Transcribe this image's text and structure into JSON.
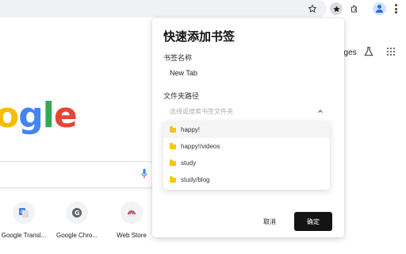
{
  "toolbar": {
    "icons": [
      "star-icon",
      "bookmark-star-icon",
      "extensions-puzzle-icon",
      "profile-avatar-icon",
      "more-menu-icon"
    ]
  },
  "ntp": {
    "link_fragment": "ages",
    "logo_fragment": [
      "o",
      "g",
      "l",
      "e"
    ],
    "shortcuts": [
      {
        "label": "Google Transl...",
        "icon": "google-translate-icon"
      },
      {
        "label": "Google Chro...",
        "icon": "google-g-icon"
      },
      {
        "label": "Web Store",
        "icon": "chrome-web-store-icon"
      }
    ]
  },
  "popup": {
    "title": "快速添加书签",
    "name_label": "书签名称",
    "name_value": "New Tab",
    "folder_label": "文件夹路径",
    "folder_placeholder": "选择或搜索书签文件夹",
    "folders": [
      "happy!",
      "happy!/videos",
      "study",
      "study/blog"
    ],
    "highlighted_index": 0,
    "cancel_label": "取消",
    "confirm_label": "确定"
  },
  "colors": {
    "confirm_button_bg": "#141414",
    "folder_icon": "#f5c518",
    "google_blue": "#4285f4",
    "google_red": "#ea4335",
    "google_yellow": "#fbbc05",
    "google_green": "#34a853"
  }
}
